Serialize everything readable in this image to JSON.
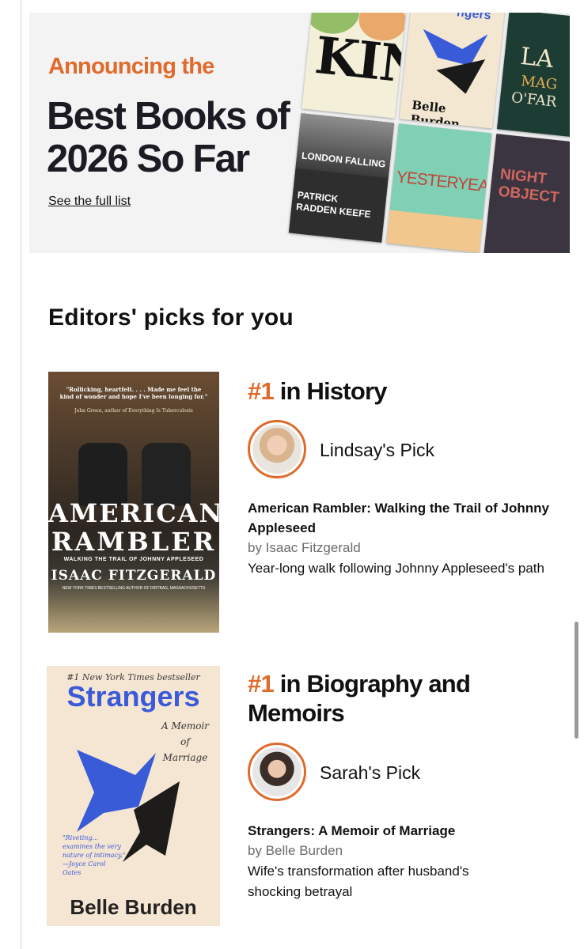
{
  "banner": {
    "announce": "Announcing the",
    "title": "Best Books of 2026 So Far",
    "link": "See the full list",
    "covers": {
      "kin": "KIN",
      "strangers_top": "ngers",
      "belle": "Belle Burden",
      "la": "LA",
      "mag": "MAG",
      "ofar": "O'FAR",
      "london": "LONDON FALLING",
      "patrick": "PATRICK RADDEN KEEFE",
      "yester": "YESTERYEAR",
      "night": "NIGHT OBJECT"
    }
  },
  "section": {
    "heading": "Editors' picks for you"
  },
  "picks": [
    {
      "rank_num": "#1",
      "rank_category": " in History",
      "picker": "Lindsay's Pick",
      "title": "American Rambler: Walking the Trail of Johnny Appleseed",
      "author": "by Isaac Fitzgerald",
      "description": "Year-long walk following Johnny Appleseed's path",
      "cover": {
        "quote": "\"Rollicking, heartfelt. . . . Made me feel the kind of wonder and hope I've been longing for.\"",
        "quote_by": "John Green, author of Everything Is Tuberculosis",
        "line1": "AMERICAN",
        "line2": "RAMBLER",
        "sub": "WALKING THE TRAIL OF JOHNNY APPLESEED",
        "author": "ISAAC FITZGERALD",
        "tag": "NEW YORK TIMES BESTSELLING AUTHOR OF DIRTBAG, MASSACHUSETTS"
      }
    },
    {
      "rank_num": "#1",
      "rank_category": " in Biography and Memoirs",
      "picker": "Sarah's Pick",
      "title": "Strangers: A Memoir of Marriage",
      "author": "by Belle Burden",
      "description": "Wife's transformation after husband's shocking betrayal",
      "cover": {
        "badge": "#1 New York Times bestseller",
        "title": "Strangers",
        "subtitle": "A Memoir of Marriage",
        "quote": "\"Riveting... examines the very nature of intimacy.\" —Joyce Carol Oates",
        "author": "Belle Burden"
      }
    }
  ],
  "colors": {
    "accent": "#e06a2b",
    "banner_bg": "#f3f3f3",
    "title_dark": "#1b1b24"
  }
}
